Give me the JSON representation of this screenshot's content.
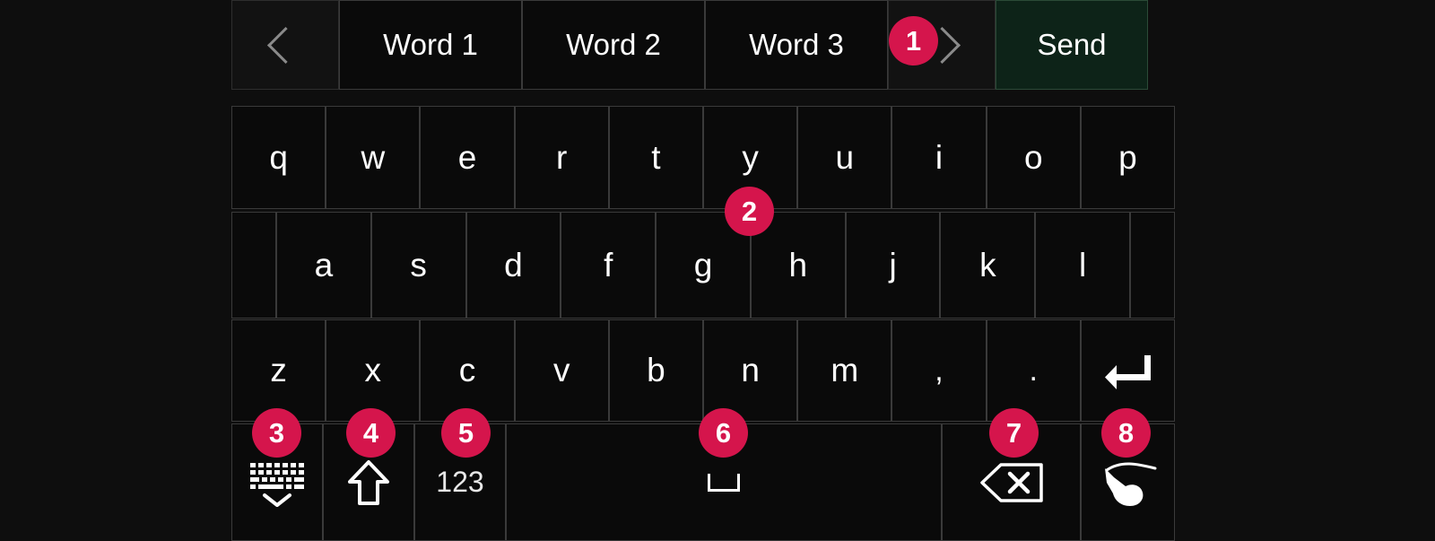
{
  "theme": {
    "background": "#0e0e0e",
    "key_fill": "#0a0a0a",
    "key_border": "#3a3a3a",
    "key_text": "#ffffff",
    "send_fill": "#0d2318",
    "send_border": "#2b4a37",
    "badge_fill": "#d5154c",
    "badge_text": "#ffffff",
    "arrow_color": "#7b7b7b"
  },
  "suggestion_bar": {
    "prev_icon": "chevron-left-icon",
    "next_icon": "chevron-right-icon",
    "words": [
      "Word 1",
      "Word 2",
      "Word 3"
    ],
    "send_label": "Send"
  },
  "keyboard": {
    "row1": [
      "q",
      "w",
      "e",
      "r",
      "t",
      "y",
      "u",
      "i",
      "o",
      "p"
    ],
    "row2": [
      "a",
      "s",
      "d",
      "f",
      "g",
      "h",
      "j",
      "k",
      "l"
    ],
    "row3": [
      "z",
      "x",
      "c",
      "v",
      "b",
      "n",
      "m",
      ",",
      "."
    ],
    "enter_icon": "enter-return-icon",
    "row4": {
      "hide_keyboard_icon": "hide-keyboard-icon",
      "shift_icon": "shift-arrow-icon",
      "numbers_label": "123",
      "space_icon": "space-bar-icon",
      "backspace_icon": "backspace-delete-icon",
      "handwriting_icon": "handwriting-hand-icon"
    }
  },
  "badges": [
    {
      "label": "1",
      "target": "suggestion-word-3"
    },
    {
      "label": "2",
      "target": "key-y"
    },
    {
      "label": "3",
      "target": "hide-keyboard-key"
    },
    {
      "label": "4",
      "target": "shift-key"
    },
    {
      "label": "5",
      "target": "numbers-key"
    },
    {
      "label": "6",
      "target": "space-key"
    },
    {
      "label": "7",
      "target": "backspace-key"
    },
    {
      "label": "8",
      "target": "handwriting-key"
    }
  ]
}
